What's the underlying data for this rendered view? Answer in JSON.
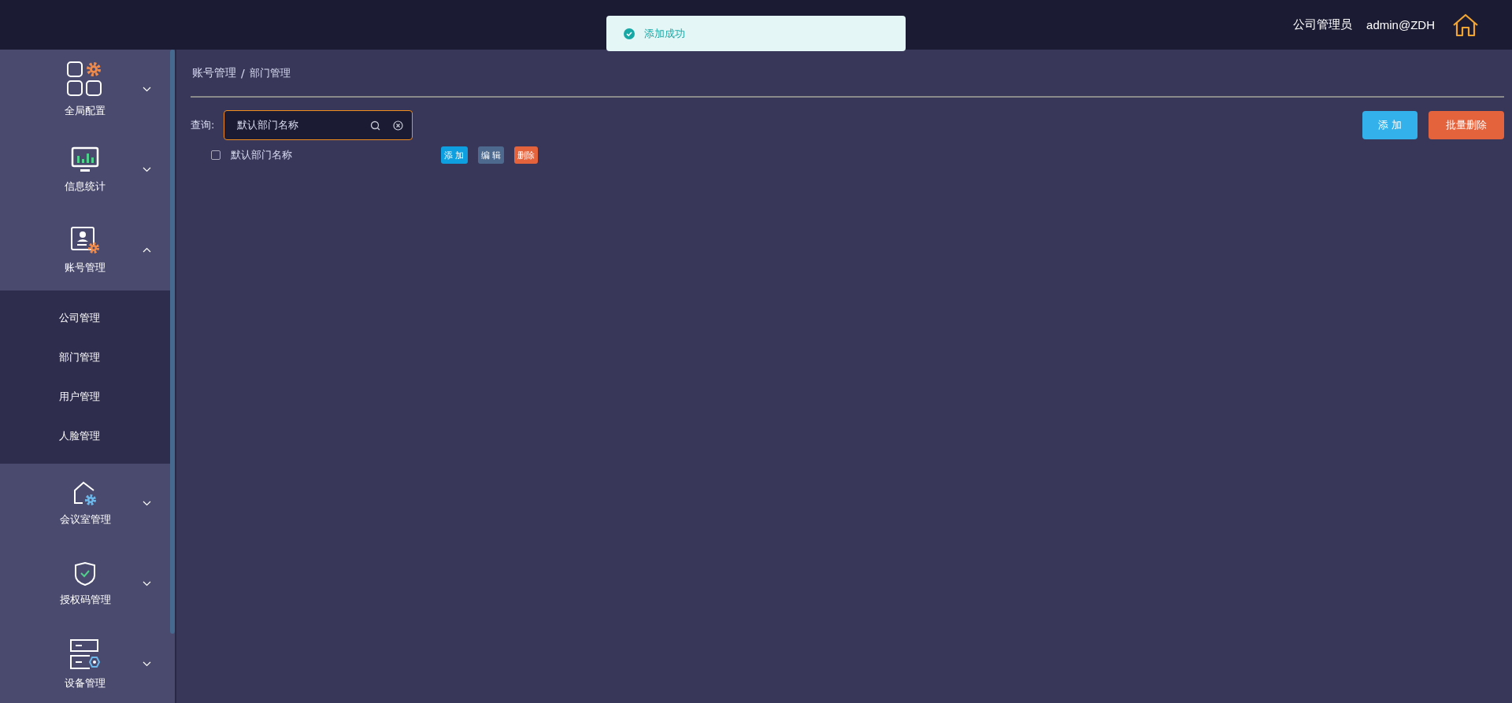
{
  "header": {
    "role": "公司管理员",
    "user": "admin@ZDH"
  },
  "toast": {
    "kind": "success",
    "message": "添加成功"
  },
  "sidebar": {
    "items": [
      {
        "label": "全局配置",
        "kind": "grid",
        "expanded": false
      },
      {
        "label": "信息统计",
        "kind": "monitor",
        "expanded": false
      },
      {
        "label": "账号管理",
        "kind": "account",
        "expanded": true,
        "children": [
          {
            "label": "公司管理"
          },
          {
            "label": "部门管理"
          },
          {
            "label": "用户管理"
          },
          {
            "label": "人脸管理"
          }
        ]
      },
      {
        "label": "会议室管理",
        "kind": "room",
        "expanded": false
      },
      {
        "label": "授权码管理",
        "kind": "shield",
        "expanded": false
      },
      {
        "label": "设备管理",
        "kind": "device",
        "expanded": false
      }
    ]
  },
  "breadcrumb": [
    "账号管理",
    "部门管理"
  ],
  "breadcrumb_separator": "/",
  "search": {
    "label": "查询:",
    "value": "默认部门名称"
  },
  "toolbar": [
    {
      "label": "添 加",
      "kind": "add"
    },
    {
      "label": "批量删除",
      "kind": "delete"
    }
  ],
  "tree": [
    {
      "label": "默认部门名称",
      "checked": false,
      "actions": [
        {
          "label": "添 加",
          "kind": "add"
        },
        {
          "label": "编 辑",
          "kind": "edit"
        },
        {
          "label": "删除",
          "kind": "delete"
        }
      ]
    }
  ]
}
